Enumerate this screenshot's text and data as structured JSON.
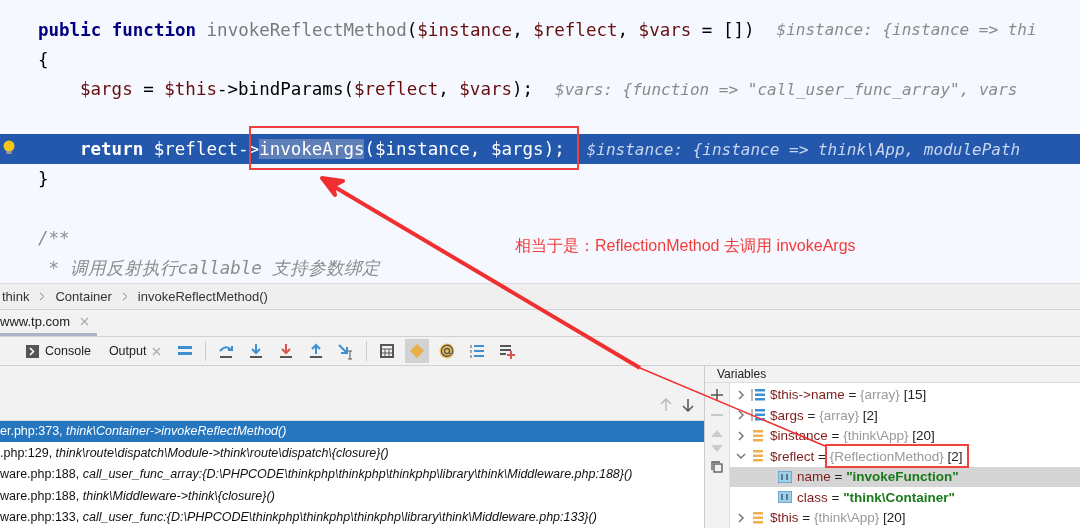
{
  "editor": {
    "lines": [
      {
        "current": false,
        "breakpoint": false,
        "tokens": [
          {
            "kind": "keyword",
            "text": "public function"
          },
          {
            "kind": "method",
            "text": " invokeReflectMethod"
          },
          {
            "kind": "plain",
            "text": "("
          },
          {
            "kind": "var",
            "text": "$instance"
          },
          {
            "kind": "plain",
            "text": ", "
          },
          {
            "kind": "var",
            "text": "$reflect"
          },
          {
            "kind": "plain",
            "text": ", "
          },
          {
            "kind": "var",
            "text": "$vars"
          },
          {
            "kind": "plain",
            "text": " = [])"
          }
        ],
        "hint": "$instance: {instance => thi"
      },
      {
        "current": false,
        "breakpoint": false,
        "tokens": [
          {
            "kind": "plain",
            "text": "{"
          }
        ],
        "children": [
          {
            "current": false,
            "breakpoint": false,
            "tokens": [
              {
                "kind": "var",
                "text": "$args"
              },
              {
                "kind": "plain",
                "text": " = "
              },
              {
                "kind": "var",
                "text": "$this"
              },
              {
                "kind": "plain",
                "text": "->bindParams("
              },
              {
                "kind": "var",
                "text": "$reflect"
              },
              {
                "kind": "plain",
                "text": ", "
              },
              {
                "kind": "var",
                "text": "$vars"
              },
              {
                "kind": "plain",
                "text": ");"
              }
            ],
            "hint": "$vars: {function => \"call_user_func_array\", vars"
          },
          {
            "current": false,
            "breakpoint": false
          },
          {
            "current": true,
            "breakpoint": true,
            "tokens": [
              {
                "kind": "keyword",
                "text": "return"
              },
              {
                "kind": "var",
                "text": " $reflect"
              },
              {
                "kind": "plain",
                "text": "->"
              },
              {
                "kind": "selection",
                "text": "invokeArgs"
              },
              {
                "kind": "plain",
                "text": "("
              },
              {
                "kind": "var",
                "text": "$instance"
              },
              {
                "kind": "plain",
                "text": ", "
              },
              {
                "kind": "var",
                "text": "$args"
              },
              {
                "kind": "plain",
                "text": ");"
              }
            ],
            "hint": "$instance: {instance => think\\App, modulePath"
          }
        ]
      },
      {
        "current": false,
        "breakpoint": false,
        "tokens": [
          {
            "kind": "plain",
            "text": "}"
          }
        ]
      },
      {
        "current": false,
        "breakpoint": false
      },
      {
        "current": false,
        "breakpoint": false,
        "tokens": [
          {
            "kind": "comment",
            "text": "/**"
          }
        ]
      },
      {
        "current": false,
        "breakpoint": false,
        "tokens": [
          {
            "kind": "comment",
            "text": " * 调用反射执行callable 支持参数绑定"
          }
        ]
      }
    ]
  },
  "annotation": {
    "text": "相当于是：ReflectionMethod 去调用 invokeArgs"
  },
  "breadcrumbs": [
    "think",
    "Container",
    "invokeReflectMethod()"
  ],
  "session_tabs": [
    {
      "label": "www.tp.com",
      "selected": true
    }
  ],
  "debug_toolbar": {
    "tabs": [
      {
        "label": "Console",
        "kind": "console"
      },
      {
        "label": "Output",
        "kind": "closable"
      }
    ],
    "buttons": [
      {
        "kind": "frames",
        "selected": false
      },
      {
        "kind": "step-over",
        "selected": false
      },
      {
        "kind": "step-into",
        "selected": false
      },
      {
        "kind": "force-step-into",
        "selected": false
      },
      {
        "kind": "step-out",
        "selected": false
      },
      {
        "kind": "run-to-cursor",
        "selected": false
      },
      {
        "kind": "evaluate",
        "selected": false
      },
      {
        "kind": "class",
        "selected": true
      },
      {
        "kind": "at",
        "selected": false
      },
      {
        "kind": "numbered",
        "selected": false
      },
      {
        "kind": "add-list",
        "selected": false
      }
    ]
  },
  "frames": [
    {
      "location": "er.php:373, ",
      "call": "think\\Container->invokeReflectMethod()",
      "selected": true
    },
    {
      "location": ".php:129, ",
      "call": "think\\route\\dispatch\\Module->think\\route\\dispatch\\{closure}()",
      "selected": false
    },
    {
      "location": "ware.php:188, ",
      "call": "call_user_func_array:{D:\\PHPCODE\\thinkphp\\thinkphp\\thinkphp\\library\\think\\Middleware.php:188}()",
      "selected": false
    },
    {
      "location": "ware.php:188, ",
      "call": "think\\Middleware->think\\{closure}()",
      "selected": false
    },
    {
      "location": "ware.php:133, ",
      "call": "call_user_func:{D:\\PHPCODE\\thinkphp\\thinkphp\\thinkphp\\library\\think\\Middleware.php:133}()",
      "selected": false
    }
  ],
  "variables": {
    "title": "Variables",
    "items": [
      {
        "name": "$this->name",
        "sep": "=",
        "type": "{array}",
        "size": "[15]",
        "kind": "array",
        "expanded": false,
        "selected": false
      },
      {
        "name": "$args",
        "sep": "=",
        "type": "{array}",
        "size": "[2]",
        "kind": "array",
        "expanded": false,
        "selected": false
      },
      {
        "name": "$instance",
        "sep": "=",
        "type": "{think\\App}",
        "size": "[20]",
        "kind": "object",
        "expanded": false,
        "selected": false
      },
      {
        "name": "$reflect",
        "sep": "=",
        "type": "{ReflectionMethod}",
        "size": "[2]",
        "kind": "object",
        "expanded": true,
        "selected": false,
        "children": [
          {
            "name": "name",
            "sep": "=",
            "value": "\"invokeFunction\"",
            "selected": true
          },
          {
            "name": "class",
            "sep": "=",
            "value": "\"think\\Container\"",
            "selected": false
          }
        ]
      },
      {
        "name": "$this",
        "sep": "=",
        "type": "{think\\App}",
        "size": "[20]",
        "kind": "object",
        "expanded": false,
        "selected": false
      }
    ]
  }
}
